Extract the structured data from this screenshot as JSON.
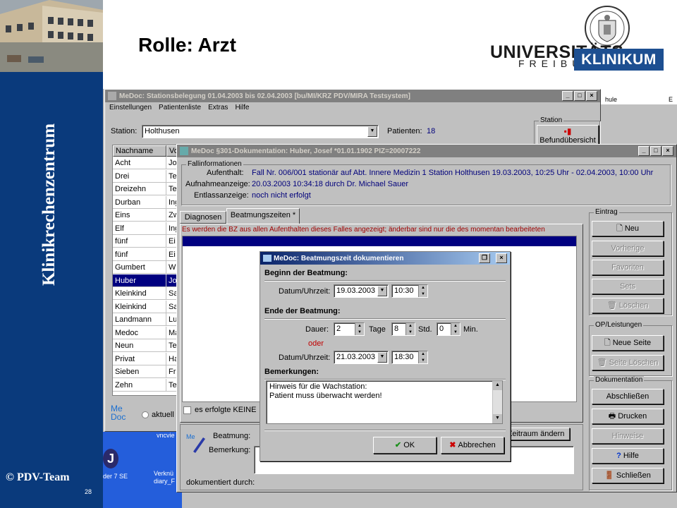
{
  "slide": {
    "title": "Rolle: Arzt",
    "side_title": "Klinikrechenzentrum",
    "copyright": "© PDV-Team",
    "page": "28",
    "logo_universitaets": "UNIVERSITÄTS",
    "logo_freiburg": "FREIBURG",
    "logo_klinikum": "KLINIKUM"
  },
  "colors": {
    "sidebar": "#0a3a7c",
    "klinikum": "#1d4f91",
    "titlebar": "#0a246a",
    "selection": "#000080",
    "error_text": "#a00000"
  },
  "stations": {
    "title": "MeDoc: Stationsbelegung 01.04.2003 bis 02.04.2003  [bu/MI/KRZ PDV/MIRA Testsystem]",
    "menu": [
      "Einstellungen",
      "Patientenliste",
      "Extras",
      "Hilfe"
    ],
    "station_label": "Station:",
    "station_value": "Holthusen",
    "patients_label": "Patienten:",
    "patients_count": "18",
    "group_station": "Station",
    "befund_button": "Befundübersicht",
    "col_nachname": "Nachname",
    "col_vorname": "Vo",
    "rows": [
      {
        "n": "Acht",
        "v": "Jo"
      },
      {
        "n": "Drei",
        "v": "Te"
      },
      {
        "n": "Dreizehn",
        "v": "Te"
      },
      {
        "n": "Durban",
        "v": "Ing"
      },
      {
        "n": "Eins",
        "v": "Zw"
      },
      {
        "n": "Elf",
        "v": "Ing"
      },
      {
        "n": "fünf",
        "v": "Ei"
      },
      {
        "n": "fünf",
        "v": "Ei"
      },
      {
        "n": "Gumbert",
        "v": "W"
      },
      {
        "n": "Huber",
        "v": "Jo"
      },
      {
        "n": "Kleinkind",
        "v": "Sa"
      },
      {
        "n": "Kleinkind",
        "v": "Sa"
      },
      {
        "n": "Landmann",
        "v": "Lu"
      },
      {
        "n": "Medoc",
        "v": "Ma"
      },
      {
        "n": "Neun",
        "v": "Te"
      },
      {
        "n": "Privat",
        "v": "Ha"
      },
      {
        "n": "Sieben",
        "v": "Fr"
      },
      {
        "n": "Zehn",
        "v": "Te"
      }
    ],
    "selected_index": 9,
    "medoc_logo": "Me Doc",
    "radio_label": "aktuell"
  },
  "desktop": {
    "right_top": "hule",
    "right_top2": "E",
    "vnc": "vncvie",
    "task1": "der 7 SE",
    "task2": "Verknü diary_F",
    "j": "J"
  },
  "doc": {
    "title": "MeDoc §301-Dokumentation: Huber, Josef *01.01.1902 PIZ=20007222",
    "fall_group": "Fallinformationen",
    "aufenthalt_label": "Aufenthalt:",
    "aufenthalt_value": "Fall Nr. 006/001 stationär auf Abt. Innere Medizin 1 Station Holthusen 19.03.2003, 10:25 Uhr - 02.04.2003, 10:00 Uhr",
    "aufnahme_label": "Aufnahmeanzeige:",
    "aufnahme_value": "20.03.2003 10:34:18 durch Dr. Michael Sauer",
    "entlass_label": "Entlassanzeige:",
    "entlass_value": "noch nicht erfolgt",
    "tab_diagnosen": "Diagnosen",
    "tab_beatmung": "Beatmungszeiten *",
    "info_text": "Es werden die BZ aus allen Aufenthalten dieses Falles angezeigt; änderbar sind  nur die des momentan bearbeiteten",
    "checkbox_label": "es erfolgte KEINE",
    "beatmung_label": "Beatmung:",
    "bemerkung_label": "Bemerkung:",
    "zeitraum_button": "Zeitraum ändern",
    "dokumentiert": "dokumentiert durch:",
    "eintrag_group": "Eintrag",
    "btn_neu": "Neu",
    "btn_vorherige": "Vorherige",
    "btn_favoriten": "Favoriten",
    "btn_sets": "Sets",
    "btn_loeschen": "Löschen",
    "op_group": "OP/Leistungen",
    "btn_neue_seite": "Neue Seite",
    "btn_seite_loeschen": "Seite Löschen",
    "dokumentation_group": "Dokumentation",
    "btn_abschliessen": "Abschließen",
    "btn_drucken": "Drucken",
    "btn_hinweise": "Hinweise",
    "btn_hilfe": "Hilfe",
    "btn_schliessen": "Schließen"
  },
  "dialog": {
    "title": "MeDoc: Beatmungszeit dokumentieren",
    "beginn_section": "Beginn der Beatmung:",
    "datum_label": "Datum/Uhrzeit:",
    "beginn_date": "19.03.2003",
    "beginn_time": "10:30",
    "ende_section": "Ende der Beatmung:",
    "dauer_label": "Dauer:",
    "dauer_tage": "2",
    "tage_label": "Tage",
    "dauer_std": "8",
    "std_label": "Std.",
    "dauer_min": "0",
    "min_label": "Min.",
    "oder": "oder",
    "ende_date": "21.03.2003",
    "ende_time": "18:30",
    "bemerkungen_section": "Bemerkungen:",
    "note_line1": "Hinweis für die Wachstation:",
    "note_line2": "Patient muss überwacht werden!",
    "ok": "OK",
    "abbrechen": "Abbrechen"
  }
}
